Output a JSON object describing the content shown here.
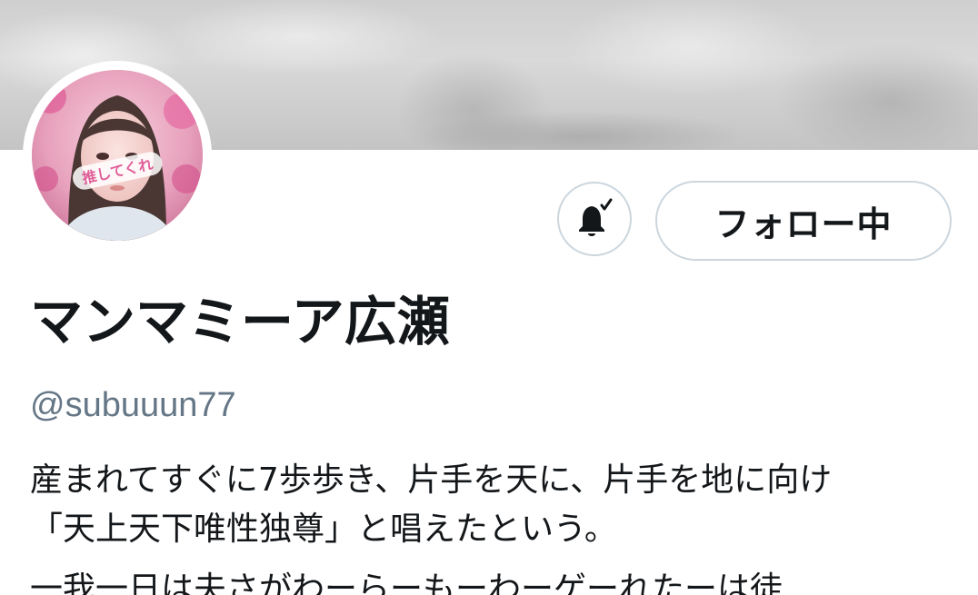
{
  "profile": {
    "display_name": "マンマミーア広瀬",
    "handle": "@subuuun77",
    "bio_lines": [
      "産まれてすぐに7歩歩き、片手を天に、片手を地に向け",
      "「天上天下唯性独尊」と唱えたという。",
      "一我一日は夫さがわーらーもーわーゲーれたーは徒"
    ],
    "avatar_text": "推してくれ"
  },
  "actions": {
    "follow_label": "フォロー中",
    "notification_icon": "bell-check-icon"
  },
  "colors": {
    "text_primary": "#14171a",
    "text_secondary": "#657786",
    "button_border": "#ccd6dd",
    "banner": "#cfcfcf"
  }
}
